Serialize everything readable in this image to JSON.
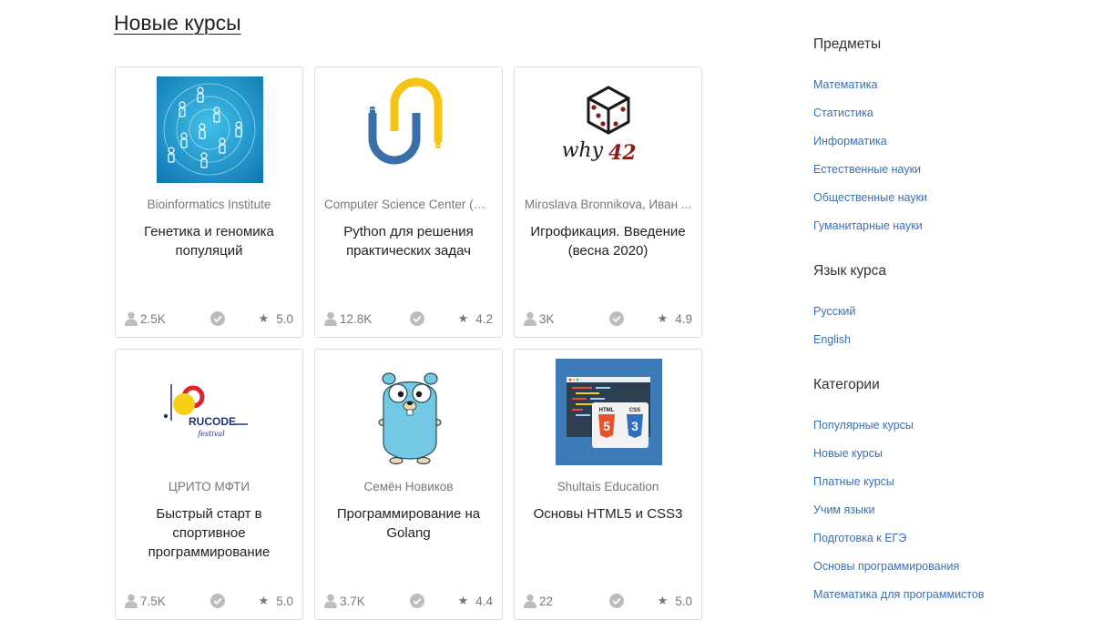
{
  "page": {
    "title": "Новые курсы"
  },
  "courses": [
    {
      "author": "Bioinformatics Institute",
      "title": "Генетика и геномика популяций",
      "learners": "2.5K",
      "rating": "5.0",
      "cover_icon": "population-genetics-cover",
      "colors": {
        "cover_bg": "#1e9fd3"
      }
    },
    {
      "author": "Computer Science Center (CS...",
      "title": "Python для решения практических задач",
      "learners": "12.8K",
      "rating": "4.2",
      "cover_icon": "python-snake-cover",
      "colors": {
        "blue": "#3a6faa",
        "yellow": "#f6c415"
      }
    },
    {
      "author": "Miroslava Bronnikova,  Иван ...",
      "title": "Игрофикация. Введение (весна 2020)",
      "learners": "3K",
      "rating": "4.9",
      "cover_icon": "dice-why42-cover",
      "cover_text_left": "why",
      "cover_text_right": "42",
      "colors": {
        "dark": "#1a1a1a",
        "red": "#8b1a1a"
      }
    },
    {
      "author": "ЦРИТО МФТИ",
      "title": "Быстрый старт в спортивное программирование",
      "learners": "7.5K",
      "rating": "5.0",
      "cover_icon": "rucode-festival-logo",
      "cover_text_top": "RUCODE",
      "cover_text_bottom": "festival",
      "colors": {
        "yellow": "#f7d117",
        "red": "#e1232a",
        "navy": "#23337a"
      }
    },
    {
      "author": "Семён Новиков",
      "title": "Программирование на Golang",
      "learners": "3.7K",
      "rating": "4.4",
      "cover_icon": "golang-gopher-cover",
      "colors": {
        "gopher": "#73c9e4"
      }
    },
    {
      "author": "Shultais Education",
      "title": "Основы HTML5 и CSS3",
      "learners": "22",
      "rating": "5.0",
      "cover_icon": "html5-css3-cover",
      "cover_text_html": "HTML",
      "cover_text_css": "CSS",
      "badge_html": "5",
      "badge_css": "3",
      "colors": {
        "bg": "#3d7ab8",
        "html": "#e5532d",
        "css": "#2d6fc0"
      }
    }
  ],
  "sidebar": {
    "subjects_heading": "Предметы",
    "subjects": [
      "Математика",
      "Статистика",
      "Информатика",
      "Естественные науки",
      "Общественные науки",
      "Гуманитарные науки"
    ],
    "language_heading": "Язык курса",
    "languages": [
      "Русский",
      "English"
    ],
    "categories_heading": "Категории",
    "categories": [
      "Популярные курсы",
      "Новые курсы",
      "Платные курсы",
      "Учим языки",
      "Подготовка к ЕГЭ",
      "Основы программирования",
      "Математика для программистов"
    ]
  },
  "icons": {
    "learners": "user-icon",
    "certificate": "certificate-check-icon",
    "rating": "star-icon"
  },
  "colors": {
    "link": "#3b6fb6",
    "muted": "#777777",
    "card_border": "#dcdcdc"
  }
}
